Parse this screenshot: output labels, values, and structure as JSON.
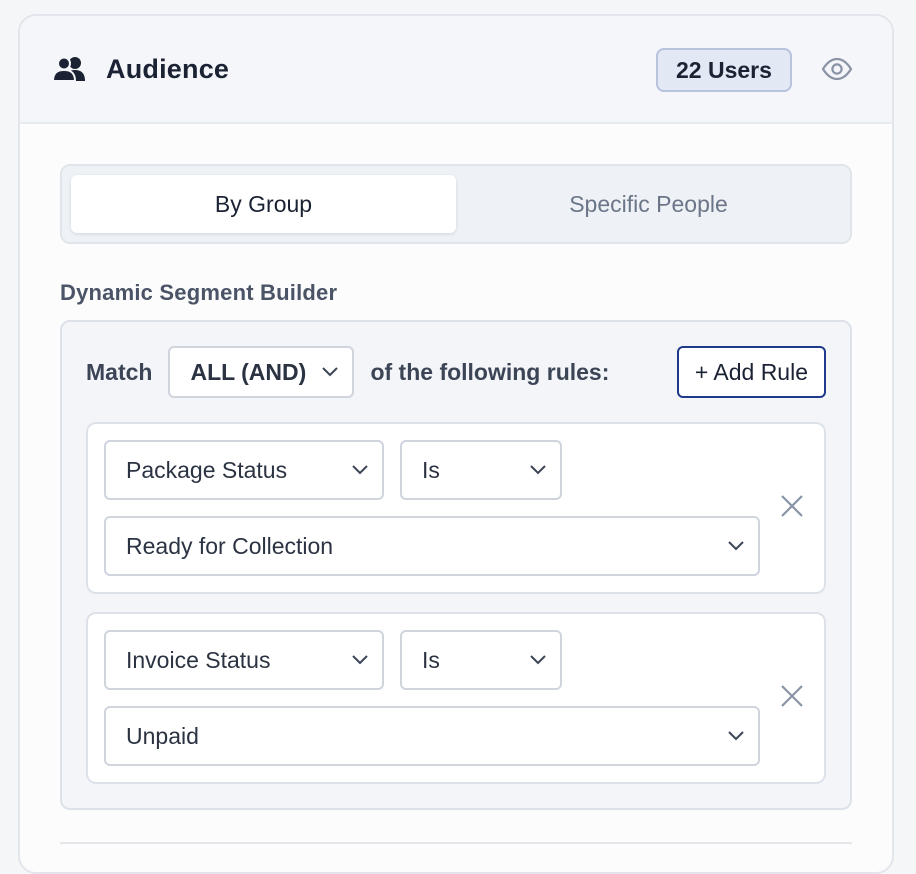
{
  "header": {
    "title": "Audience",
    "icon": "users-icon",
    "users_badge": "22 Users",
    "visibility_icon": "eye-icon"
  },
  "tabs": [
    {
      "label": "By Group",
      "active": true
    },
    {
      "label": "Specific People",
      "active": false
    }
  ],
  "builder": {
    "section_label": "Dynamic Segment Builder",
    "match_prefix": "Match",
    "match_value": "ALL (AND)",
    "match_suffix": "of the following rules:",
    "add_rule_label": "+ Add Rule",
    "rules": [
      {
        "field": "Package Status",
        "operator": "Is",
        "value": "Ready for Collection"
      },
      {
        "field": "Invoice Status",
        "operator": "Is",
        "value": "Unpaid"
      }
    ]
  },
  "colors": {
    "accent_border": "#1f3a8a",
    "badge_bg": "#e3e8f5",
    "text_primary": "#1a2233",
    "text_muted": "#6b7689"
  }
}
